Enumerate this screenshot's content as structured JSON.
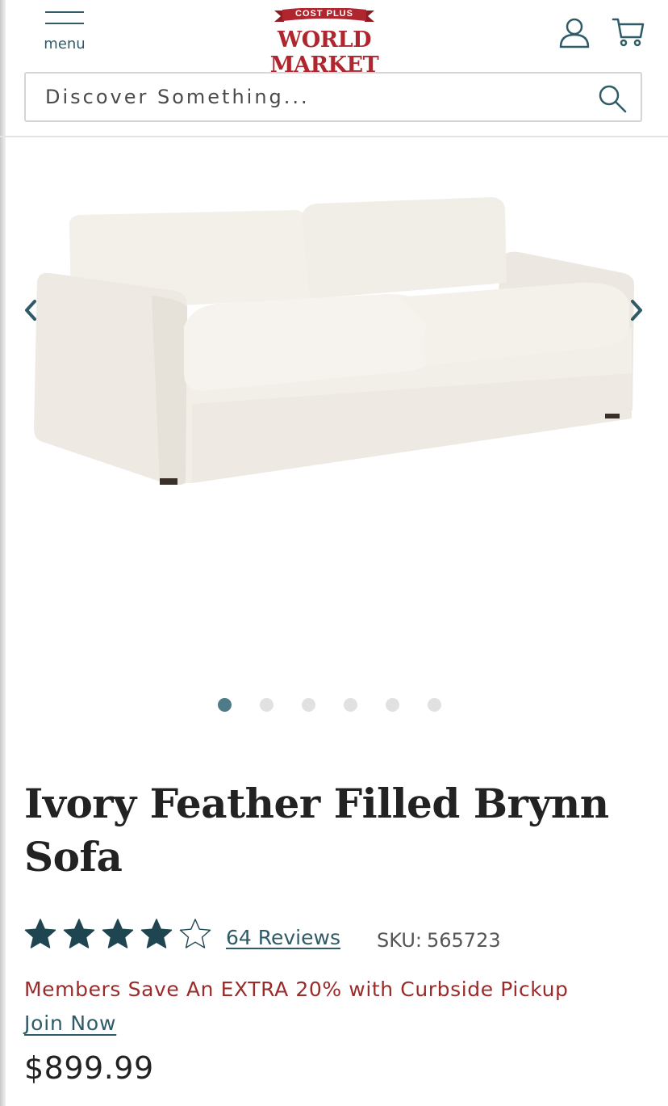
{
  "header": {
    "menu_label": "menu",
    "logo": {
      "banner_text": "COST PLUS",
      "wordmark": "WORLD MARKET"
    },
    "icons": {
      "account": "account-icon",
      "cart": "cart-icon",
      "menu": "hamburger-icon",
      "search": "search-icon"
    }
  },
  "search": {
    "placeholder": "Discover Something..."
  },
  "carousel": {
    "image_alt": "sofa-image",
    "slide_count": 6,
    "active_index": 0,
    "arrows": [
      "chevron-left-icon",
      "chevron-right-icon"
    ]
  },
  "product": {
    "title": "Ivory Feather Filled Brynn Sofa",
    "rating": 4,
    "rating_max": 5,
    "reviews_label": "64 Reviews",
    "sku_label": "SKU:",
    "sku_value": "565723",
    "promo_text": "Members Save An EXTRA 20% with Curbside Pickup",
    "join_label": "Join Now",
    "price": "$899.99"
  },
  "colors": {
    "brand_red": "#b0262e",
    "teal": "#2f5b67",
    "star_fill": "#1f4650",
    "promo_red": "#9b2a2a",
    "dot_active": "#4d7b87",
    "dot_inactive": "#e1e1e1"
  }
}
